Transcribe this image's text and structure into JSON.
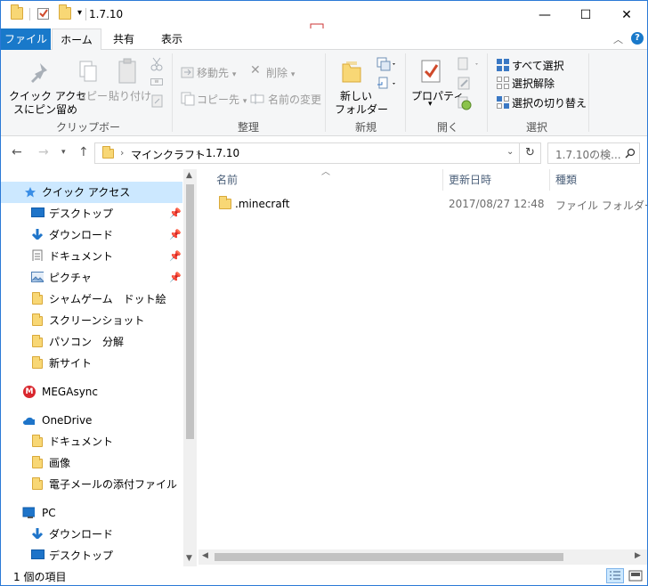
{
  "window": {
    "title": "1.7.10",
    "controls": {
      "minimize": "—",
      "maximize": "☐",
      "close": "✕"
    }
  },
  "ribbon_tabs": [
    "ファイル",
    "ホーム",
    "共有",
    "表示"
  ],
  "ribbon": {
    "clipboard": {
      "pin_quick_access": [
        "クイック アクセ",
        "スにピン留め"
      ],
      "copy": "コピー",
      "paste": "貼り付け",
      "group_label": "クリップボード"
    },
    "organize": {
      "move_to": "移動先",
      "copy_to": "コピー先",
      "delete": "削除",
      "rename": "名前の変更",
      "group_label": "整理"
    },
    "new": {
      "new_folder": [
        "新しい",
        "フォルダー"
      ],
      "group_label": "新規"
    },
    "open": {
      "properties": "プロパティ",
      "group_label": "開く"
    },
    "select": {
      "select_all": "すべて選択",
      "select_none": "選択解除",
      "invert_selection": "選択の切り替え",
      "group_label": "選択"
    }
  },
  "address": {
    "crumbs": [
      "マインクラフト",
      "1.7.10"
    ],
    "search_placeholder": "1.7.10の検..."
  },
  "nav": {
    "quick_access": "クイック アクセス",
    "pinned": [
      {
        "label": "デスクトップ",
        "icon": "desktop-icon"
      },
      {
        "label": "ダウンロード",
        "icon": "download-icon"
      },
      {
        "label": "ドキュメント",
        "icon": "document-icon"
      },
      {
        "label": "ピクチャ",
        "icon": "picture-icon"
      }
    ],
    "folders": [
      "シャムゲーム　ドット絵",
      "スクリーンショット",
      "パソコン　分解",
      "新サイト"
    ],
    "mega": "MEGAsync",
    "onedrive": "OneDrive",
    "onedrive_items": [
      "ドキュメント",
      "画像",
      "電子メールの添付ファイル"
    ],
    "pc": "PC",
    "pc_items": [
      "ダウンロード",
      "デスクトップ"
    ]
  },
  "columns": {
    "name": "名前",
    "date": "更新日時",
    "type": "種類"
  },
  "files": [
    {
      "name": ".minecraft",
      "date": "2017/08/27 12:48",
      "type": "ファイル フォルダー"
    }
  ],
  "status": {
    "count": "1 個の項目"
  },
  "colors": {
    "accent": "#1979ca",
    "selection": "#cce8ff",
    "folder": "#f8d775"
  }
}
